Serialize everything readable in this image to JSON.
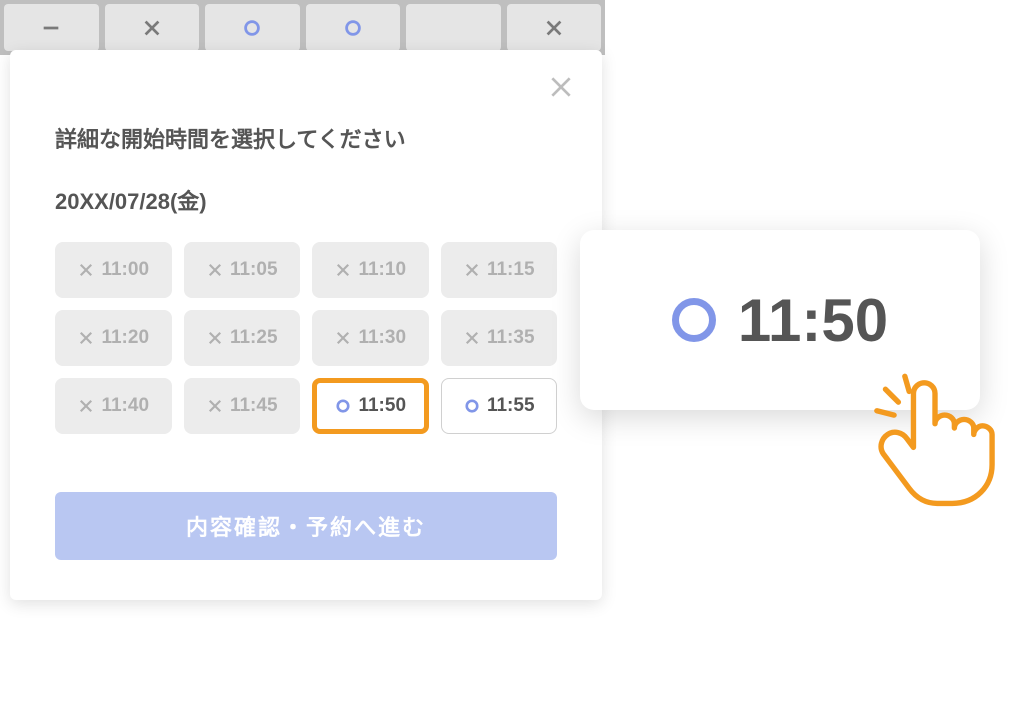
{
  "modal": {
    "title": "詳細な開始時間を選択してください",
    "date": "20XX/07/28(金)",
    "submit_label": "内容確認・予約へ進む"
  },
  "slots": [
    {
      "time": "11:00",
      "status": "unavailable"
    },
    {
      "time": "11:05",
      "status": "unavailable"
    },
    {
      "time": "11:10",
      "status": "unavailable"
    },
    {
      "time": "11:15",
      "status": "unavailable"
    },
    {
      "time": "11:20",
      "status": "unavailable"
    },
    {
      "time": "11:25",
      "status": "unavailable"
    },
    {
      "time": "11:30",
      "status": "unavailable"
    },
    {
      "time": "11:35",
      "status": "unavailable"
    },
    {
      "time": "11:40",
      "status": "unavailable"
    },
    {
      "time": "11:45",
      "status": "unavailable"
    },
    {
      "time": "11:50",
      "status": "selected"
    },
    {
      "time": "11:55",
      "status": "available"
    }
  ],
  "zoom": {
    "time": "11:50"
  },
  "colors": {
    "accent_orange": "#f39a1f",
    "accent_blue": "#8196e8",
    "button_blue": "#b9c7f2"
  }
}
